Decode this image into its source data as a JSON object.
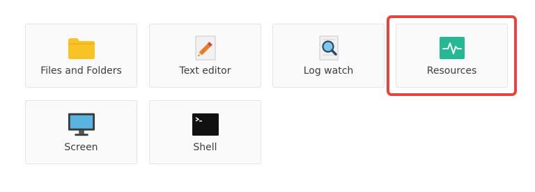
{
  "tiles": [
    {
      "label": "Files and Folders",
      "icon": "folder-icon"
    },
    {
      "label": "Text editor",
      "icon": "text-editor-icon"
    },
    {
      "label": "Log watch",
      "icon": "log-watch-icon"
    },
    {
      "label": "Resources",
      "icon": "resources-icon"
    },
    {
      "label": "Screen",
      "icon": "monitor-icon"
    },
    {
      "label": "Shell",
      "icon": "terminal-icon"
    }
  ],
  "highlighted_tile": "Resources",
  "colors": {
    "folder": "#f7c325",
    "resources": "#26b892",
    "screen": "#59b5e0",
    "highlight": "#e8433f"
  }
}
